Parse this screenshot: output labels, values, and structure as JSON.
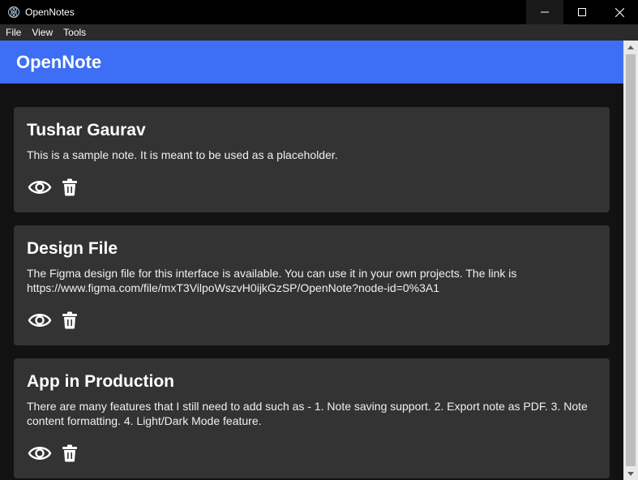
{
  "window": {
    "title": "OpenNotes",
    "controls": [
      "minimize-icon",
      "maximize-icon",
      "close-icon"
    ]
  },
  "menu": {
    "file": "File",
    "view": "View",
    "tools": "Tools"
  },
  "header": {
    "title": "OpenNote",
    "accent": "#3d6ef5"
  },
  "notes": [
    {
      "title": "Tushar Gaurav",
      "body": "This is a sample note. It is meant to be used as a placeholder."
    },
    {
      "title": "Design File",
      "body": "The Figma design file for this interface is available. You can use it in your own projects. The link is https://www.figma.com/file/mxT3VilpoWszvH0ijkGzSP/OpenNote?node-id=0%3A1"
    },
    {
      "title": "App in Production",
      "body": "There are many features that I still need to add such as - 1. Note saving support. 2. Export note as PDF. 3. Note content formatting. 4. Light/Dark Mode feature."
    }
  ],
  "icons": {
    "view": "eye-icon",
    "delete": "trash-icon"
  }
}
